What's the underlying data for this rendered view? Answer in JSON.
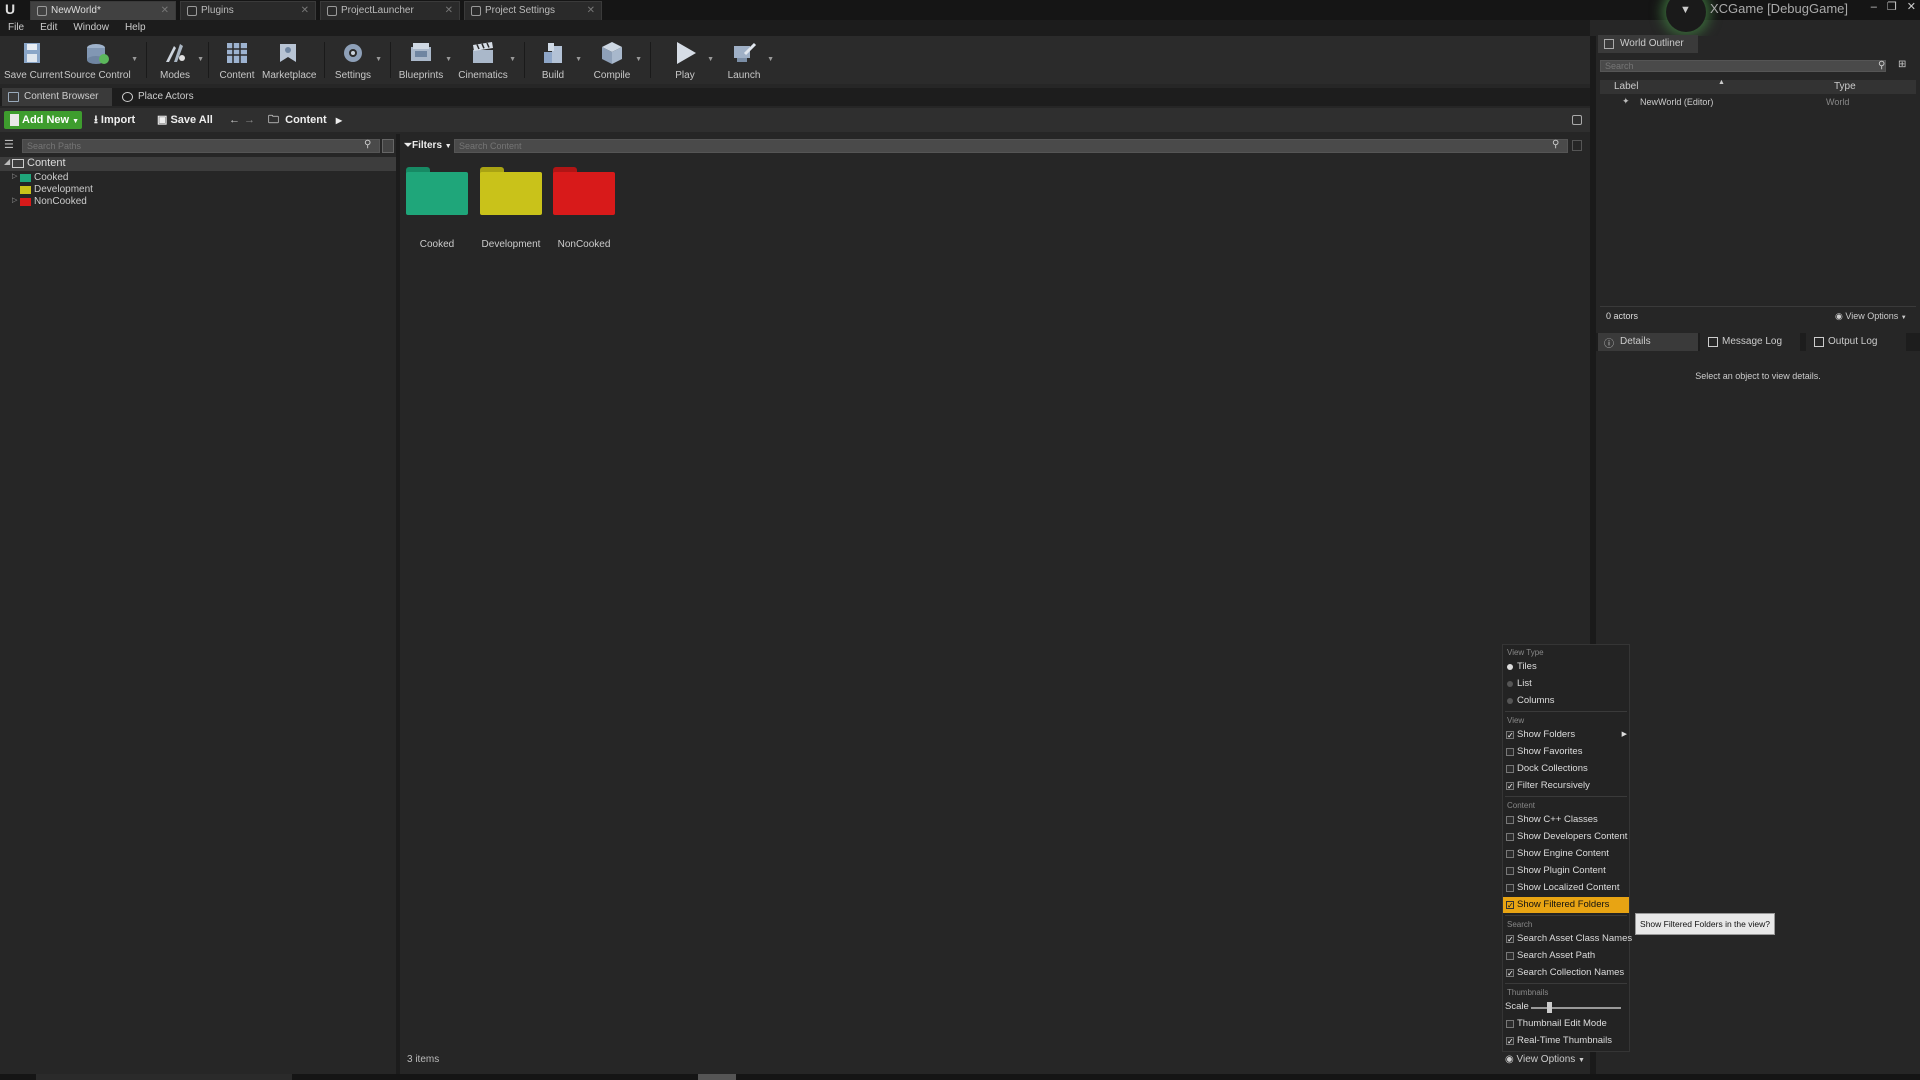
{
  "app": {
    "tabs": [
      {
        "label": "NewWorld*",
        "active": true
      },
      {
        "label": "Plugins"
      },
      {
        "label": "ProjectLauncher"
      },
      {
        "label": "Project Settings"
      }
    ],
    "project_name": "XCGame [DebugGame]",
    "window_controls": [
      "–",
      "❐",
      "✕"
    ]
  },
  "menu": [
    "File",
    "Edit",
    "Window",
    "Help"
  ],
  "toolbar": {
    "items": [
      {
        "label": "Save Current",
        "icon": "save-icon"
      },
      {
        "label": "Source Control",
        "icon": "source-control-icon"
      },
      {
        "label": "Modes",
        "icon": "modes-icon"
      },
      {
        "label": "Content",
        "icon": "content-icon"
      },
      {
        "label": "Marketplace",
        "icon": "marketplace-icon"
      },
      {
        "label": "Settings",
        "icon": "settings-icon"
      },
      {
        "label": "Blueprints",
        "icon": "blueprints-icon"
      },
      {
        "label": "Cinematics",
        "icon": "cinematics-icon"
      },
      {
        "label": "Build",
        "icon": "build-icon"
      },
      {
        "label": "Compile",
        "icon": "compile-icon"
      },
      {
        "label": "Play",
        "icon": "play-icon"
      },
      {
        "label": "Launch",
        "icon": "launch-icon"
      }
    ]
  },
  "content_browser": {
    "tabs": [
      "Content Browser",
      "Place Actors"
    ],
    "add_new": "Add New",
    "import": "Import",
    "save_all": "Save All",
    "path": "Content",
    "search_paths_placeholder": "Search Paths",
    "filters": "Filters",
    "search_content_placeholder": "Search Content",
    "tree": {
      "root": "Content",
      "children": [
        {
          "label": "Cooked",
          "color": "#1fa67a"
        },
        {
          "label": "Development",
          "color": "#c9c21a"
        },
        {
          "label": "NonCooked",
          "color": "#d81a1a"
        }
      ]
    },
    "folders": [
      {
        "label": "Cooked",
        "color": "#1fa67a"
      },
      {
        "label": "Development",
        "color": "#c9c21a"
      },
      {
        "label": "NonCooked",
        "color": "#d81a1a"
      }
    ],
    "item_count": "3 items",
    "view_options": "View Options"
  },
  "world_outliner": {
    "title": "World Outliner",
    "search_placeholder": "Search",
    "columns": {
      "label": "Label",
      "type": "Type"
    },
    "rows": [
      {
        "label": "NewWorld (Editor)",
        "type": "World"
      }
    ],
    "actor_count": "0 actors",
    "view_options": "View Options"
  },
  "details": {
    "tabs": [
      "Details",
      "Message Log",
      "Output Log"
    ],
    "empty_message": "Select an object to view details."
  },
  "view_menu": {
    "sections": {
      "view_type": "View Type",
      "view": "View",
      "content": "Content",
      "search": "Search",
      "thumbnails": "Thumbnails"
    },
    "view_type": [
      {
        "label": "Tiles",
        "selected": true
      },
      {
        "label": "List",
        "selected": false
      },
      {
        "label": "Columns",
        "selected": false
      }
    ],
    "view": [
      {
        "label": "Show Folders",
        "checked": true
      },
      {
        "label": "Show Favorites",
        "checked": false
      },
      {
        "label": "Dock Collections",
        "checked": false
      },
      {
        "label": "Filter Recursively",
        "checked": true
      }
    ],
    "content": [
      {
        "label": "Show C++ Classes",
        "checked": false
      },
      {
        "label": "Show Developers Content",
        "checked": false
      },
      {
        "label": "Show Engine Content",
        "checked": false
      },
      {
        "label": "Show Plugin Content",
        "checked": false
      },
      {
        "label": "Show Localized Content",
        "checked": false
      },
      {
        "label": "Show Filtered Folders",
        "checked": true,
        "highlighted": true
      }
    ],
    "search": [
      {
        "label": "Search Asset Class Names",
        "checked": true
      },
      {
        "label": "Search Asset Path",
        "checked": false
      },
      {
        "label": "Search Collection Names",
        "checked": true
      }
    ],
    "scale_label": "Scale",
    "scale_value": 0.2,
    "thumbnails": [
      {
        "label": "Thumbnail Edit Mode",
        "checked": false
      },
      {
        "label": "Real-Time Thumbnails",
        "checked": true
      }
    ],
    "tooltip": "Show Filtered Folders in the view?"
  },
  "colors": {
    "accent": "#e8a413",
    "add_new": "#3e9d2e"
  }
}
